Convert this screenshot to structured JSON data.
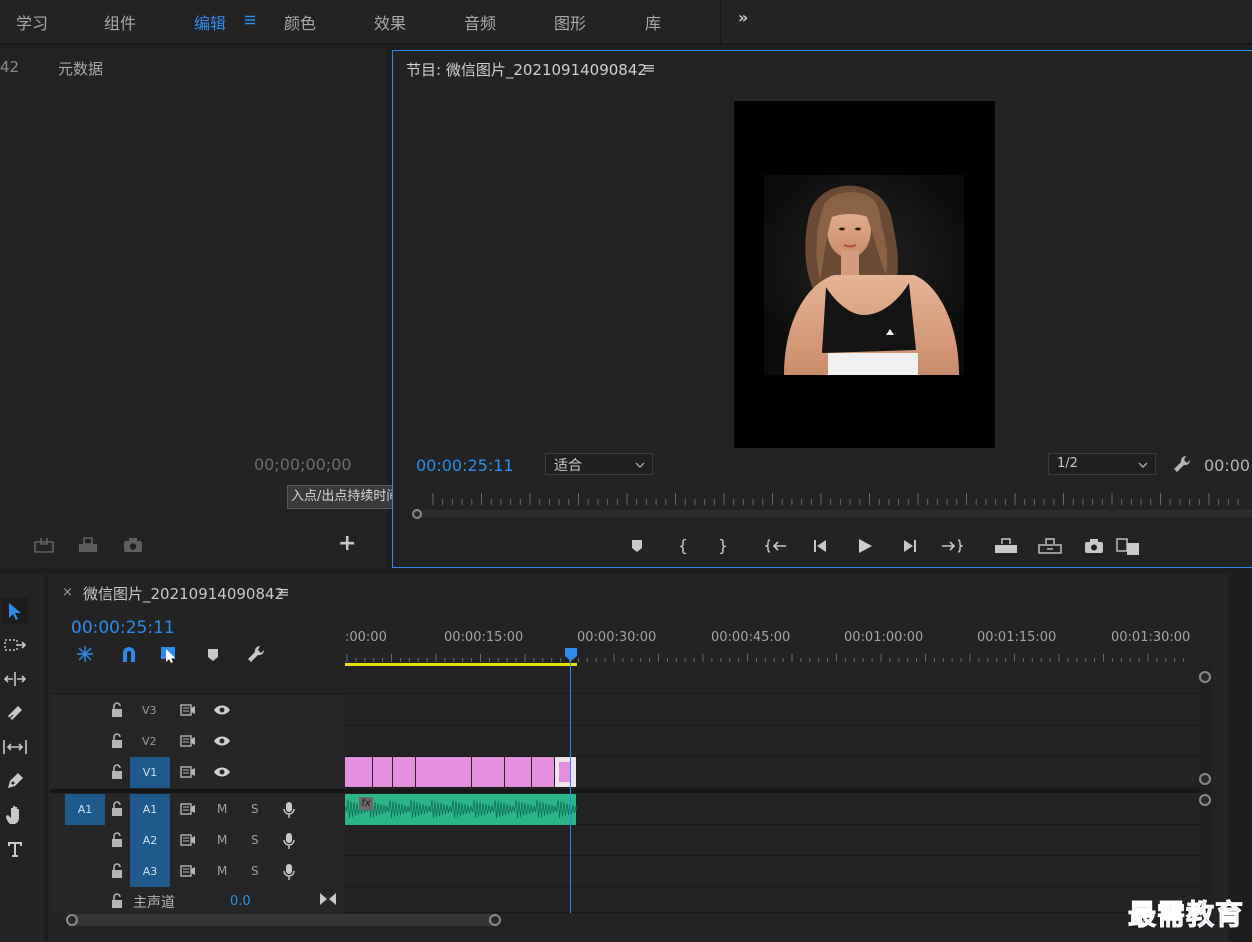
{
  "workspaces": [
    {
      "label": "学习",
      "active": false
    },
    {
      "label": "组件",
      "active": false
    },
    {
      "label": "编辑",
      "active": true
    },
    {
      "label": "颜色",
      "active": false
    },
    {
      "label": "效果",
      "active": false
    },
    {
      "label": "音频",
      "active": false
    },
    {
      "label": "图形",
      "active": false
    },
    {
      "label": "库",
      "active": false
    }
  ],
  "workspace_menu_icon": "hamburger-icon",
  "workspace_overflow": "»",
  "left_panel": {
    "tab_prefix": "42",
    "tab_label": "元数据",
    "timecode": "00;00;00;00",
    "tooltip": "入点/出点持续时间",
    "add_button": "+"
  },
  "program_monitor": {
    "title": "节目: 微信图片_20210914090842",
    "menu_icon": "≡",
    "timecode": "00:00:25:11",
    "fit_select": "适合",
    "resolution_select": "1/2",
    "duration_partial": "00:00"
  },
  "timeline": {
    "close_glyph": "×",
    "sequence_title": "微信图片_20210914090842",
    "menu_icon": "≡",
    "timecode": "00:00:25:11",
    "ruler_labels": [
      ":00:00",
      "00:00:15:00",
      "00:00:30:00",
      "00:00:45:00",
      "00:01:00:00",
      "00:01:15:00",
      "00:01:30:00"
    ],
    "video_tracks": [
      "V3",
      "V2",
      "V1"
    ],
    "audio_tracks": [
      "A1",
      "A2",
      "A3"
    ],
    "source_patch": "A1",
    "mute_label": "M",
    "solo_label": "S",
    "master_label": "主声道",
    "master_value": "0.0",
    "fx_badge": "fx",
    "colors": {
      "video_clip": "#e38fde",
      "audio_clip": "#2db58a",
      "accent": "#2d8ceb",
      "work_area": "#e8e000"
    }
  },
  "watermark": "最需教育"
}
